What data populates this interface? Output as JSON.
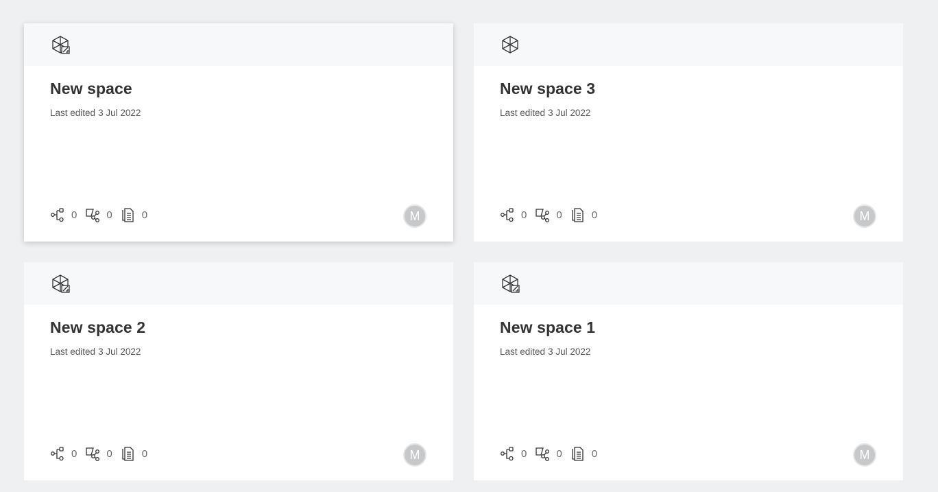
{
  "spaces": [
    {
      "title": "New space",
      "last_edited_label": "Last edited",
      "last_edited_date": "3 Jul 2022",
      "icon": "space-cube-edit-icon",
      "stats": {
        "flows": "0",
        "shared": "0",
        "documents": "0"
      },
      "owner_initial": "M",
      "state": "hovered"
    },
    {
      "title": "New space 3",
      "last_edited_label": "Last edited",
      "last_edited_date": "3 Jul 2022",
      "icon": "space-cube-icon",
      "stats": {
        "flows": "0",
        "shared": "0",
        "documents": "0"
      },
      "owner_initial": "M"
    },
    {
      "title": "New space 2",
      "last_edited_label": "Last edited",
      "last_edited_date": "3 Jul 2022",
      "icon": "space-cube-edit-icon",
      "stats": {
        "flows": "0",
        "shared": "0",
        "documents": "0"
      },
      "owner_initial": "M"
    },
    {
      "title": "New space 1",
      "last_edited_label": "Last edited",
      "last_edited_date": "3 Jul 2022",
      "icon": "space-cube-edit-icon",
      "stats": {
        "flows": "0",
        "shared": "0",
        "documents": "0"
      },
      "owner_initial": "M"
    }
  ],
  "colors": {
    "page_background": "#eff0f2",
    "card_background": "#ffffff",
    "card_header": "#f7f8fa",
    "title": "#333333",
    "avatar": "#c6c8ca"
  }
}
